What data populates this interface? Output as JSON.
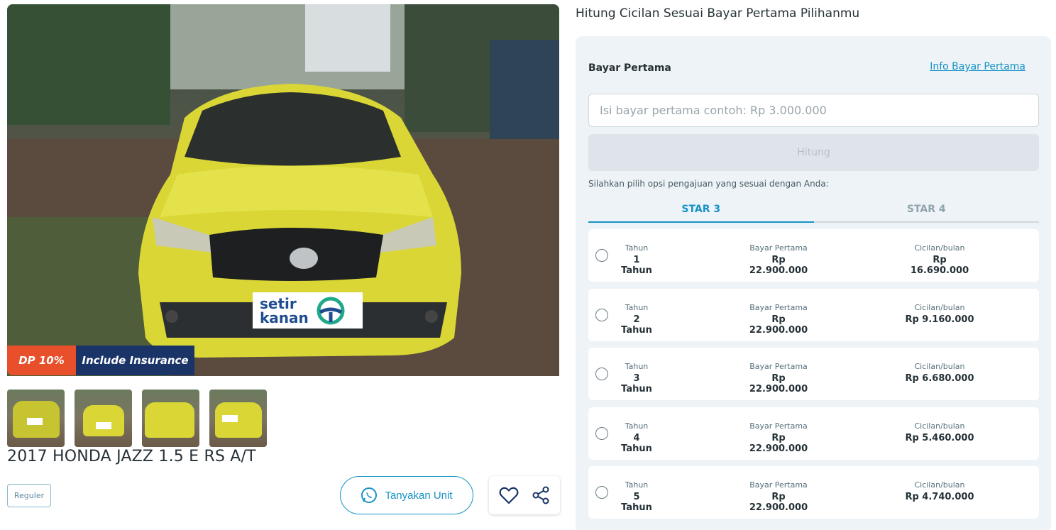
{
  "listing": {
    "dp_badge": "DP 10%",
    "insurance_badge": "Include Insurance",
    "logo_text_top": "setir",
    "logo_text_bottom": "kanan",
    "title": "2017 HONDA JAZZ 1.5 E RS A/T",
    "category_tag": "Reguler",
    "ask_button": "Tanyakan Unit",
    "car_color": "#d9d636",
    "accent_color": "#1692c6"
  },
  "calculator": {
    "heading": "Hitung Cicilan Sesuai Bayar Pertama Pilihanmu",
    "bayar_pertama_label": "Bayar Pertama",
    "info_link": "Info Bayar Pertama",
    "input_placeholder": "Isi bayar pertama contoh: Rp 3.000.000",
    "input_value": "",
    "submit_button": "Hitung",
    "hint": "Silahkan pilih opsi pengajuan yang sesuai dengan Anda:",
    "tabs": [
      {
        "label": "STAR 3",
        "active": true
      },
      {
        "label": "STAR 4",
        "active": false
      }
    ],
    "column_labels": {
      "tenor": "Tahun",
      "down_payment": "Bayar Pertama",
      "installment": "Cicilan/bulan"
    },
    "options": [
      {
        "tenor": "1 Tahun",
        "down_payment": "Rp 22.900.000",
        "installment": "Rp 16.690.000"
      },
      {
        "tenor": "2 Tahun",
        "down_payment": "Rp 22.900.000",
        "installment": "Rp 9.160.000"
      },
      {
        "tenor": "3 Tahun",
        "down_payment": "Rp 22.900.000",
        "installment": "Rp 6.680.000"
      },
      {
        "tenor": "4 Tahun",
        "down_payment": "Rp 22.900.000",
        "installment": "Rp 5.460.000"
      },
      {
        "tenor": "5 Tahun",
        "down_payment": "Rp 22.900.000",
        "installment": "Rp 4.740.000"
      }
    ]
  }
}
